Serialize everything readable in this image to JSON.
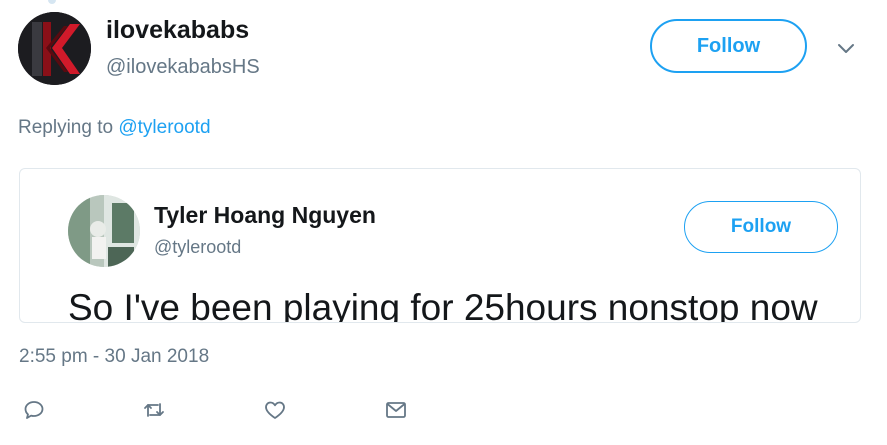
{
  "tweet": {
    "author_name": "ilovekababs",
    "author_handle": "@ilovekababsHS",
    "follow_label": "Follow",
    "replying_prefix": "Replying to ",
    "replying_mention": "@tylerootd",
    "timestamp": "2:55 pm - 30 Jan 2018"
  },
  "quoted": {
    "author_name": "Tyler Hoang Nguyen",
    "author_handle": "@tylerootd",
    "follow_label": "Follow",
    "text": "So I've been playing for 25hours nonstop now"
  },
  "icons": {
    "more": "chevron-down-icon",
    "reply": "reply-icon",
    "retweet": "retweet-icon",
    "like": "heart-icon",
    "dm": "envelope-icon"
  },
  "colors": {
    "accent": "#1da1f2",
    "secondary_text": "#657786",
    "primary_text": "#14171a",
    "border": "#e1e8ed"
  }
}
